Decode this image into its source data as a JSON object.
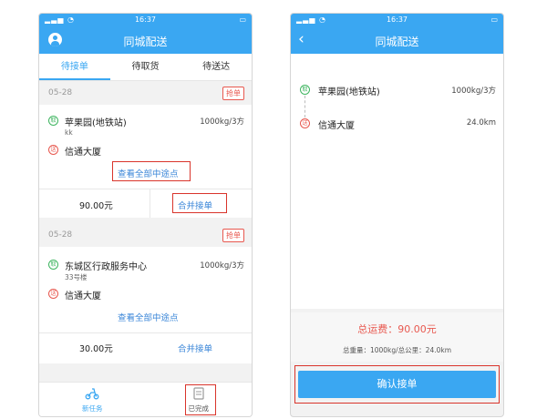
{
  "status_bar": {
    "time": "16:37"
  },
  "left": {
    "header_title": "同城配送",
    "tabs": [
      {
        "label": "待接单",
        "active": true
      },
      {
        "label": "待取货",
        "active": false
      },
      {
        "label": "待送达",
        "active": false
      }
    ],
    "orders": [
      {
        "date": "05-28",
        "badge": "抢单",
        "pickup_label": "取",
        "pickup_name": "苹果园(地铁站)",
        "pickup_sub": "kk",
        "weight": "1000kg/3方",
        "delivery_label": "送",
        "delivery_name": "信通大厦",
        "view_waypoints": "查看全部中途点",
        "price": "90.00元",
        "merge": "合并接单"
      },
      {
        "date": "05-28",
        "badge": "抢单",
        "pickup_label": "取",
        "pickup_name": "东城区行政服务中心",
        "pickup_sub": "33号楼",
        "weight": "1000kg/3方",
        "delivery_label": "送",
        "delivery_name": "信通大厦",
        "view_waypoints": "查看全部中途点",
        "price": "30.00元",
        "merge": "合并接单"
      }
    ],
    "bottom_nav": [
      {
        "label": "新任务",
        "icon": "scooter-icon"
      },
      {
        "label": "已完成",
        "icon": "document-icon"
      }
    ]
  },
  "right": {
    "header_title": "同城配送",
    "pickup_label": "取",
    "pickup_name": "苹果园(地铁站)",
    "weight": "1000kg/3方",
    "delivery_label": "送",
    "delivery_name": "信通大厦",
    "distance": "24.0km",
    "total_fee": "总运费：90.00元",
    "total_summary": "总重量：1000kg/总公里：24.0km",
    "confirm_button": "确认接单"
  },
  "colors": {
    "primary": "#3aa7f2",
    "pickup": "#3fb560",
    "delivery": "#e8584f",
    "highlight_box": "#d9342b"
  }
}
